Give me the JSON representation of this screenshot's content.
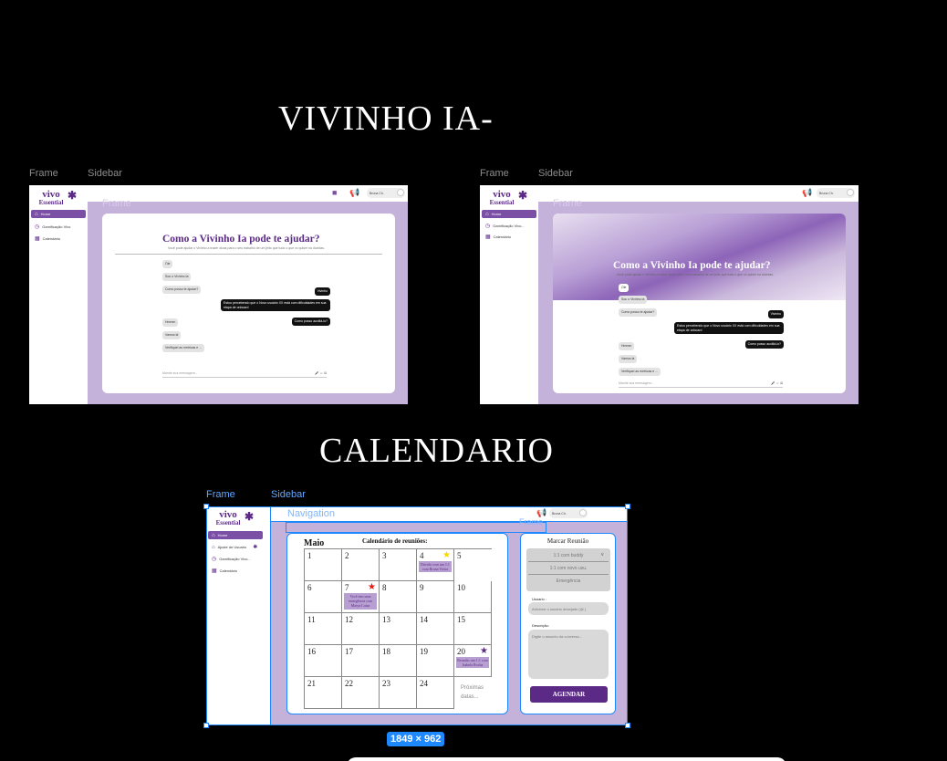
{
  "titles": {
    "vivinho": "VIVINHO IA-",
    "calendario": "CALENDARIO"
  },
  "labels": {
    "frame": "Frame",
    "sidebar": "Sidebar",
    "navigation": "Navigation",
    "frame_ghost": "Frame"
  },
  "logo": {
    "line1": "vivo",
    "line2": "Essential"
  },
  "nav": {
    "home": "Home",
    "gamificacao": "Gamificação Vivo",
    "calendario": "Calendário",
    "ajuste": "Ajuste de Usuario",
    "gamificacao_short": "Gamificação Vivo..."
  },
  "user": {
    "name": "Bruna Ch."
  },
  "chat": {
    "title": "Como a Vivinho Ia pode te ajudar?",
    "subtitle": "Você pode ajudar o Vivinho a trazer dicas para o seu trabalho de um jeito que tudo o que vc quiser na dúvidas.",
    "messages": [
      {
        "side": "left",
        "text": "Oie"
      },
      {
        "side": "left",
        "text": "Sou o Vivinho Ia"
      },
      {
        "side": "left",
        "text": "Como posso te ajudar?"
      },
      {
        "side": "right",
        "text": "Vivinho"
      },
      {
        "side": "right",
        "text": "Estou percebendo que o Novo usuário XX está com dificuldades em sua etapa de onboard"
      },
      {
        "side": "right",
        "text": "Como posso auxiliá-lo?"
      },
      {
        "side": "left",
        "text": "Hmmm"
      },
      {
        "side": "left",
        "text": "Vamos lá"
      },
      {
        "side": "left",
        "text": "Verifiquei as metricas e ..."
      }
    ],
    "input_placeholder": "Mande sua mensagem..."
  },
  "calendar": {
    "title": "Calendário de reuniões:",
    "month": "Maio",
    "days": [
      "1",
      "2",
      "3",
      "4",
      "5",
      "6",
      "7",
      "8",
      "10",
      "11",
      "12",
      "13",
      "14",
      "15",
      "16",
      "17",
      "18",
      "19",
      "20",
      "21",
      "22",
      "23",
      "24"
    ],
    "day9": "9",
    "events": [
      {
        "day": "4",
        "text": "Dúvida com um 1:1 com Bruna Vieira"
      },
      {
        "day": "7",
        "text": "Você tem uma emergência com Marya Luiza"
      },
      {
        "day": "20",
        "text": "Reunião um 1:1 com Isabela Rocha"
      }
    ],
    "next_dates": "Próximas datas..."
  },
  "booking": {
    "title": "Marcar Reunião",
    "options": [
      "1:1 com buddy",
      "1:1 com novo usu.",
      "Emergência"
    ],
    "user_label": "Usuario :",
    "user_placeholder": "Adicione o usuário desejado (@ )",
    "desc_label": "Descrição:",
    "desc_placeholder": "Digite o assunto da conversa...",
    "button": "AGENDAR"
  },
  "size_badge": "1849 × 962",
  "colors": {
    "brand": "#5b2a86",
    "bg_lavender": "#c5b2db",
    "selection": "#1e88ff"
  }
}
